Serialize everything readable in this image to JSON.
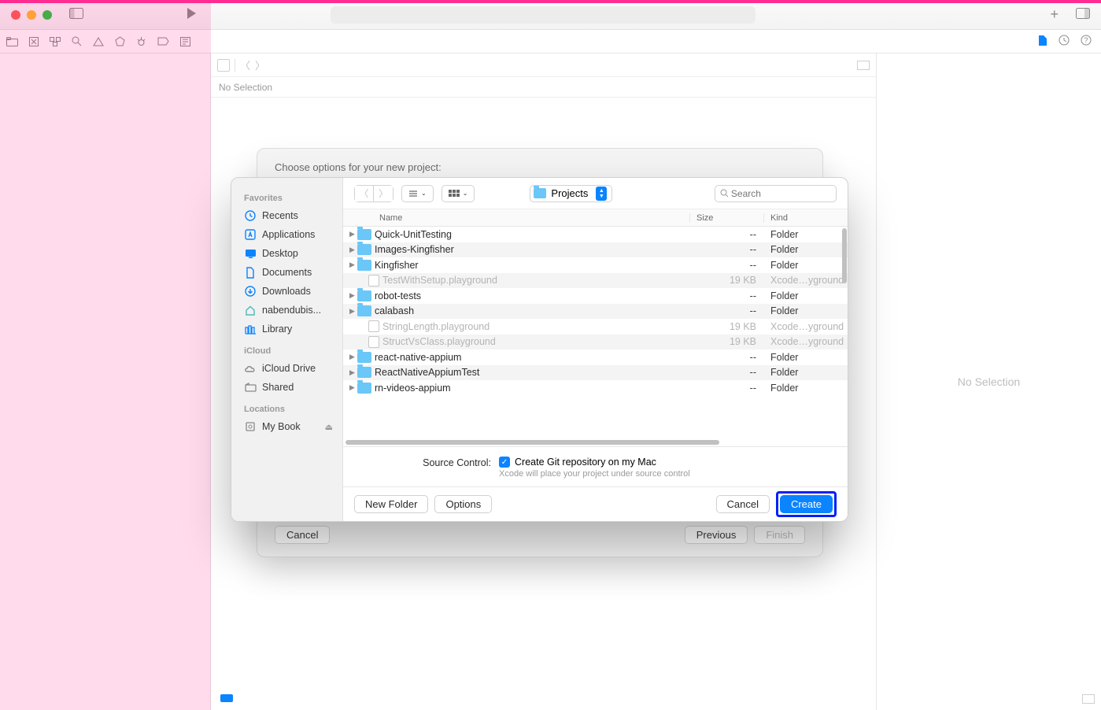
{
  "window": {
    "no_selection_top": "No Selection",
    "inspector_no_selection": "No Selection"
  },
  "sheet": {
    "title": "Choose options for your new project:",
    "cancel": "Cancel",
    "previous": "Previous",
    "finish": "Finish"
  },
  "dialog": {
    "location": "Projects",
    "search_placeholder": "Search",
    "columns": {
      "name": "Name",
      "size": "Size",
      "kind": "Kind"
    },
    "sidebar": {
      "favorites_hdr": "Favorites",
      "favorites": [
        {
          "icon": "clock",
          "label": "Recents"
        },
        {
          "icon": "app",
          "label": "Applications"
        },
        {
          "icon": "desktop",
          "label": "Desktop"
        },
        {
          "icon": "doc",
          "label": "Documents"
        },
        {
          "icon": "download",
          "label": "Downloads"
        },
        {
          "icon": "home",
          "label": "nabendubis..."
        },
        {
          "icon": "library",
          "label": "Library"
        }
      ],
      "icloud_hdr": "iCloud",
      "icloud": [
        {
          "icon": "cloud",
          "label": "iCloud Drive"
        },
        {
          "icon": "shared",
          "label": "Shared"
        }
      ],
      "locations_hdr": "Locations",
      "locations": [
        {
          "icon": "disk",
          "label": "My Book",
          "eject": true
        }
      ]
    },
    "files": [
      {
        "name": "Quick-UnitTesting",
        "size": "--",
        "kind": "Folder",
        "folder": true,
        "disclose": true
      },
      {
        "name": "Images-Kingfisher",
        "size": "--",
        "kind": "Folder",
        "folder": true,
        "disclose": true
      },
      {
        "name": "Kingfisher",
        "size": "--",
        "kind": "Folder",
        "folder": true,
        "disclose": true
      },
      {
        "name": "TestWithSetup.playground",
        "size": "19 KB",
        "kind": "Xcode…yground",
        "folder": false,
        "dim": true
      },
      {
        "name": "robot-tests",
        "size": "--",
        "kind": "Folder",
        "folder": true,
        "disclose": true
      },
      {
        "name": "calabash",
        "size": "--",
        "kind": "Folder",
        "folder": true,
        "disclose": true
      },
      {
        "name": "StringLength.playground",
        "size": "19 KB",
        "kind": "Xcode…yground",
        "folder": false,
        "dim": true
      },
      {
        "name": "StructVsClass.playground",
        "size": "19 KB",
        "kind": "Xcode…yground",
        "folder": false,
        "dim": true
      },
      {
        "name": "react-native-appium",
        "size": "--",
        "kind": "Folder",
        "folder": true,
        "disclose": true
      },
      {
        "name": "ReactNativeAppiumTest",
        "size": "--",
        "kind": "Folder",
        "folder": true,
        "disclose": true
      },
      {
        "name": "rn-videos-appium",
        "size": "--",
        "kind": "Folder",
        "folder": true,
        "disclose": true
      }
    ],
    "source_control": {
      "label": "Source Control:",
      "checkbox": "Create Git repository on my Mac",
      "hint": "Xcode will place your project under source control"
    },
    "footer": {
      "new_folder": "New Folder",
      "options": "Options",
      "cancel": "Cancel",
      "create": "Create"
    }
  }
}
